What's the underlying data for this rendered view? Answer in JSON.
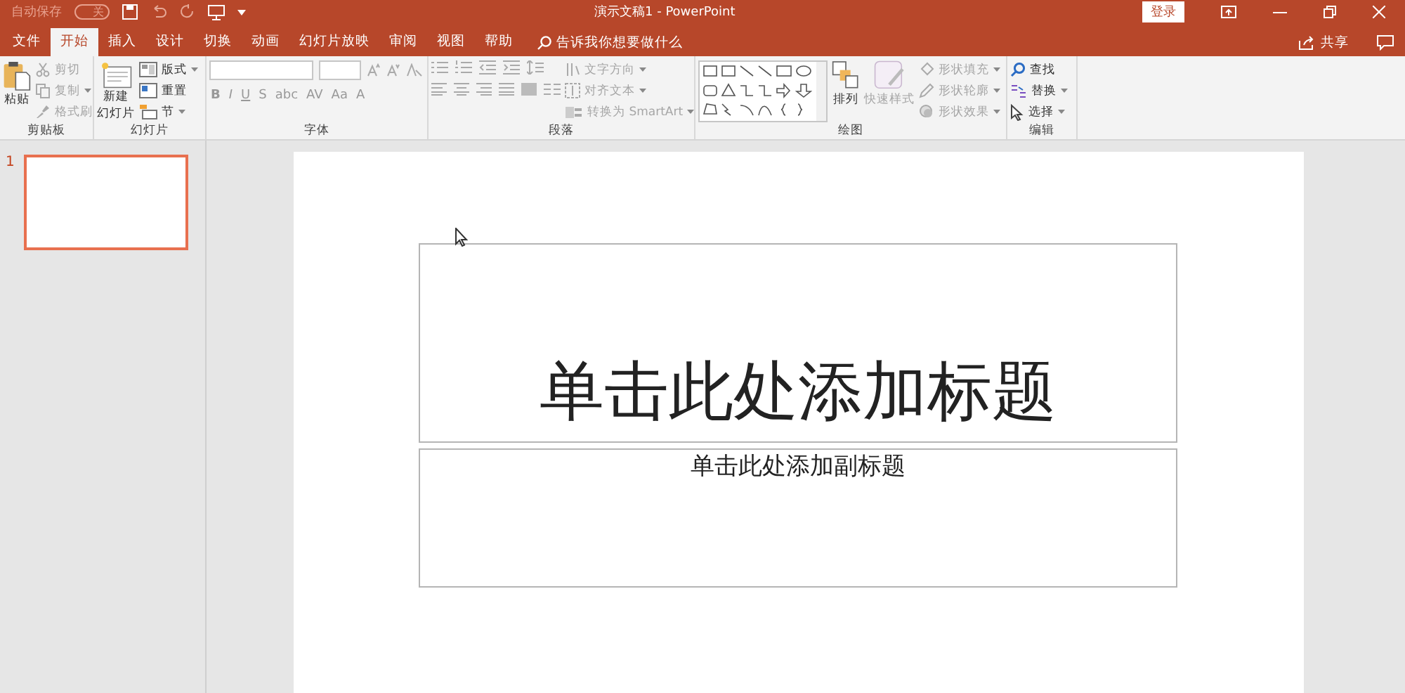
{
  "title_bar": {
    "autosave": {
      "label": "自动保存",
      "on": false,
      "state": "关"
    },
    "title": "演示文稿1 - PowerPoint",
    "sign_in": "登录"
  },
  "tabs": [
    {
      "label": "文件",
      "selected": false
    },
    {
      "label": "开始",
      "selected": true
    },
    {
      "label": "插入",
      "selected": false
    },
    {
      "label": "设计",
      "selected": false
    },
    {
      "label": "切换",
      "selected": false
    },
    {
      "label": "动画",
      "selected": false
    },
    {
      "label": "幻灯片放映",
      "selected": false
    },
    {
      "label": "审阅",
      "selected": false
    },
    {
      "label": "视图",
      "selected": false
    },
    {
      "label": "帮助",
      "selected": false
    }
  ],
  "tell_me": {
    "placeholder": "告诉我你想要做什么"
  },
  "share": "共享",
  "ribbon": {
    "groups": [
      {
        "kind": "clipboard",
        "name": "剪贴板",
        "large": [
          {
            "label_lines": [
              "粘贴"
            ],
            "disabled": false
          }
        ],
        "items": [
          {
            "label": "剪切",
            "disabled": true
          },
          {
            "label": "复制",
            "disabled": true
          },
          {
            "label": "格式刷",
            "disabled": true
          }
        ]
      },
      {
        "kind": "slides",
        "name": "幻灯片",
        "large": [
          {
            "label_lines": [
              "新建",
              "幻灯片"
            ],
            "disabled": false
          }
        ],
        "items": [
          {
            "label": "版式",
            "disabled": false
          },
          {
            "label": "重置",
            "disabled": false
          },
          {
            "label": "节",
            "disabled": false
          }
        ]
      },
      {
        "kind": "font",
        "name": "字体",
        "format_buttons": [
          "B",
          "I",
          "U",
          "S",
          "abc",
          "AV",
          "Aa",
          "A"
        ]
      },
      {
        "kind": "paragraph",
        "name": "段落",
        "items": [
          {
            "label": "文字方向",
            "disabled": true
          },
          {
            "label": "对齐文本",
            "disabled": true
          },
          {
            "label": "转换为 SmartArt",
            "disabled": true
          }
        ]
      },
      {
        "kind": "drawing",
        "name": "绘图",
        "large": [
          {
            "label_lines": [
              "排列"
            ],
            "disabled": false
          },
          {
            "label_lines": [
              "快速样式"
            ],
            "disabled": true
          }
        ],
        "items": [
          {
            "label": "形状填充",
            "disabled": true
          },
          {
            "label": "形状轮廓",
            "disabled": true
          },
          {
            "label": "形状效果",
            "disabled": true
          }
        ]
      },
      {
        "kind": "editing",
        "name": "编辑",
        "items": [
          {
            "label": "查找",
            "disabled": false
          },
          {
            "label": "替换",
            "disabled": false
          },
          {
            "label": "选择",
            "disabled": false
          }
        ]
      }
    ]
  },
  "thumbnails": [
    {
      "number": "1",
      "selected": true
    }
  ],
  "slide": {
    "title_placeholder": "单击此处添加标题",
    "subtitle_placeholder": "单击此处添加副标题"
  }
}
